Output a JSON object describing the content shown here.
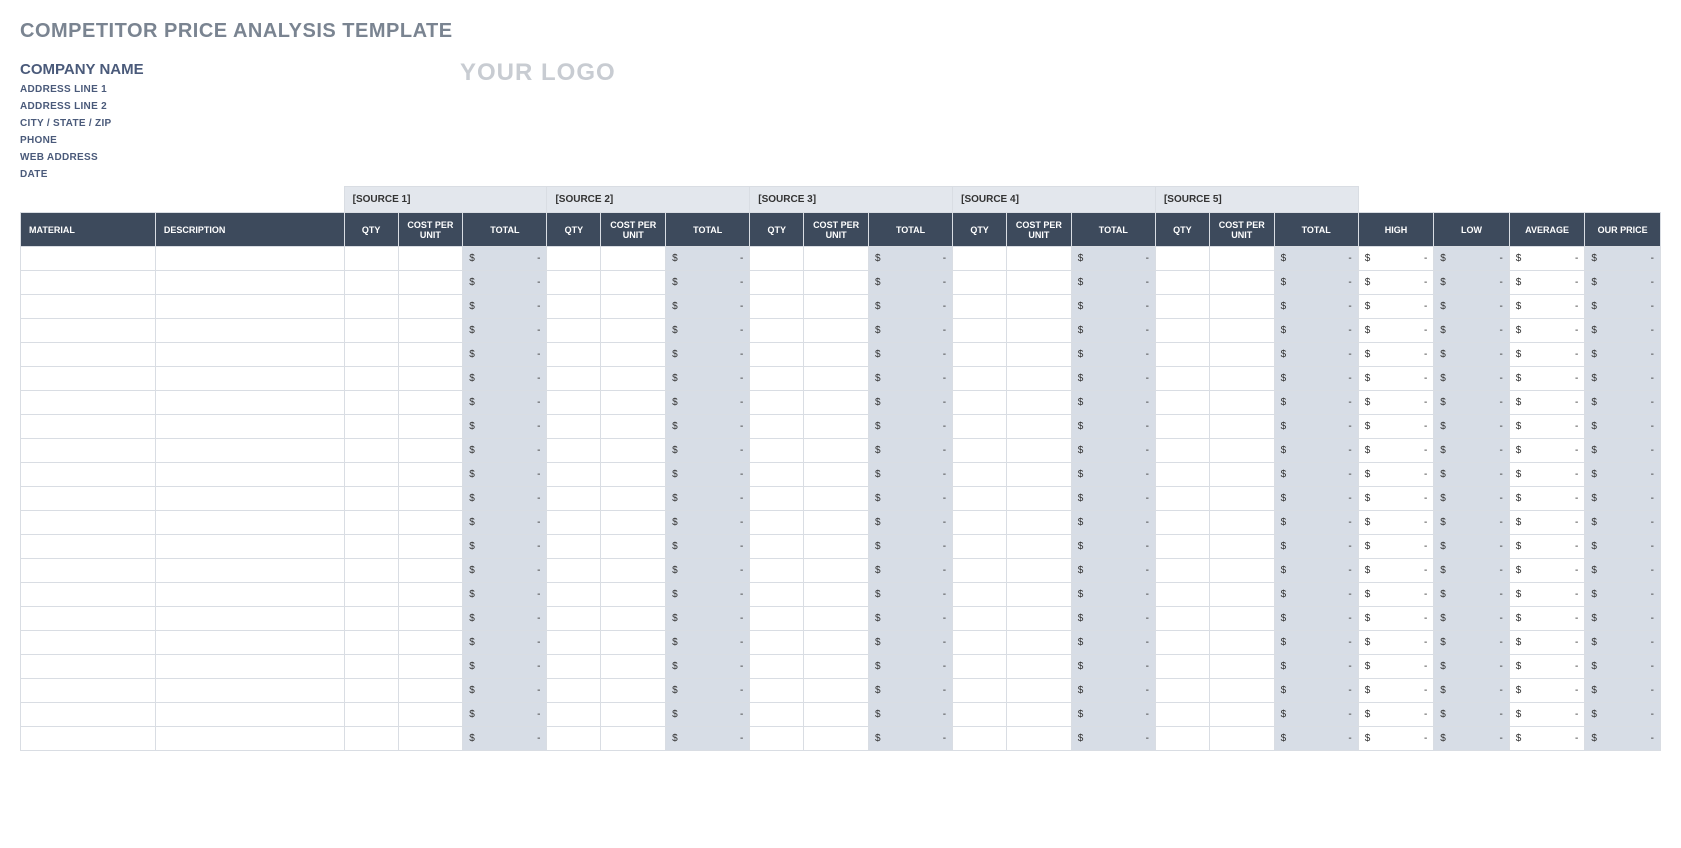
{
  "title": "COMPETITOR PRICE ANALYSIS TEMPLATE",
  "company": {
    "name": "COMPANY NAME",
    "address1": "ADDRESS LINE 1",
    "address2": "ADDRESS LINE 2",
    "city_state_zip": "CITY / STATE / ZIP",
    "phone": "PHONE",
    "web": "WEB ADDRESS",
    "date": "DATE"
  },
  "logo_text": "YOUR LOGO",
  "sources": [
    "[SOURCE 1]",
    "[SOURCE 2]",
    "[SOURCE 3]",
    "[SOURCE 4]",
    "[SOURCE 5]"
  ],
  "col_headers": {
    "material": "MATERIAL",
    "description": "DESCRIPTION",
    "qty": "QTY",
    "cost_per_unit": "COST PER UNIT",
    "total": "TOTAL",
    "high": "HIGH",
    "low": "LOW",
    "average": "AVERAGE",
    "our_price": "OUR PRICE"
  },
  "currency_symbol": "$",
  "empty_value": "-",
  "row_count": 21
}
